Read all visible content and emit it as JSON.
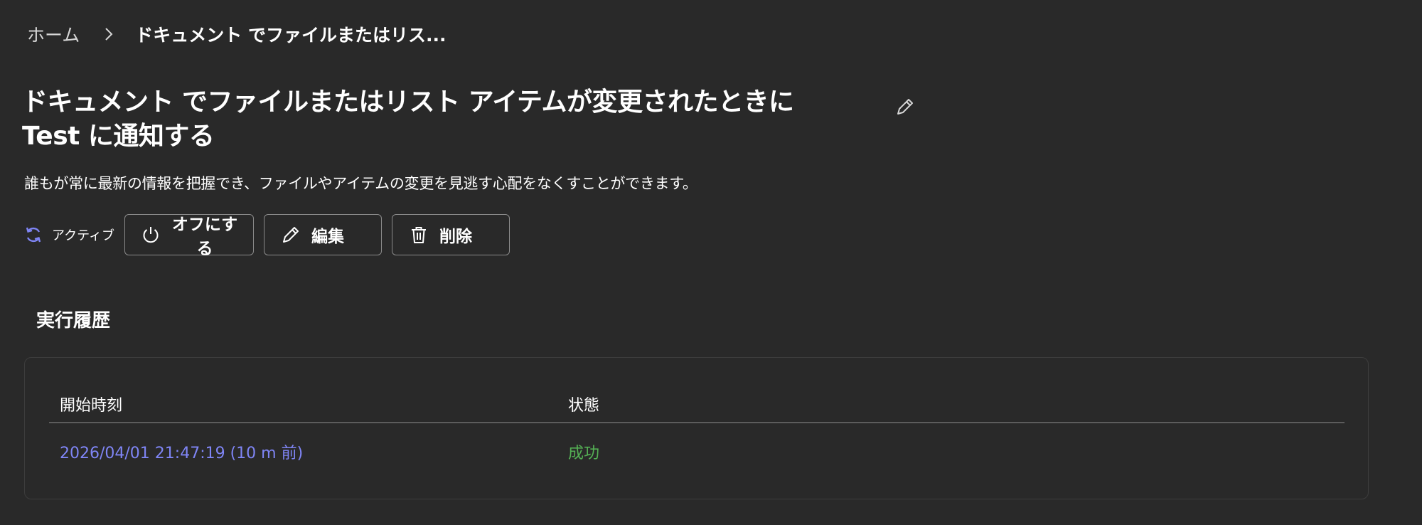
{
  "breadcrumb": {
    "home": "ホーム",
    "current": "ドキュメント でファイルまたはリス..."
  },
  "page": {
    "title": "ドキュメント でファイルまたはリスト アイテムが変更されたときに Test に通知する",
    "description": "誰もが常に最新の情報を把握でき、ファイルやアイテムの変更を見逃す心配をなくすことができます。"
  },
  "status": {
    "label": "アクティブ",
    "icon": "sync-icon",
    "color": "#7f85f5"
  },
  "actions": {
    "turn_off": "オフにする",
    "edit": "編集",
    "delete": "削除"
  },
  "run_history": {
    "title": "実行履歴",
    "columns": [
      "開始時刻",
      "状態"
    ],
    "rows": [
      {
        "start_time": "2026/04/01 21:47:19 (10 m 前)",
        "status": "成功"
      }
    ]
  },
  "colors": {
    "background": "#292929",
    "link": "#7f85f5",
    "success": "#54b054"
  }
}
